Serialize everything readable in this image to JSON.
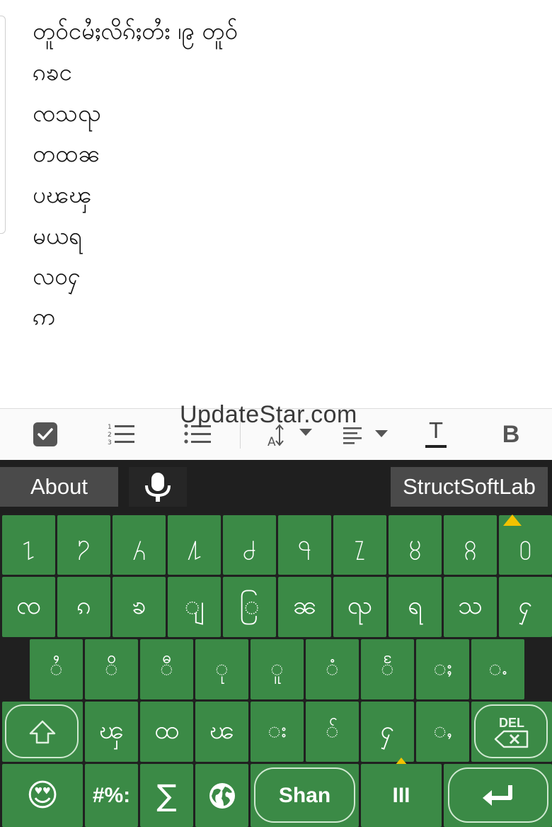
{
  "editor": {
    "lines": [
      "တူဝ်ငမႆႈလိၵ်ႈတႆး ၊၉ တူဝ်",
      "ၵၶင",
      "ၸသၺ",
      "တထၼ",
      "ပၽၾ",
      "မယရ",
      "လဝႁ",
      "ဢ"
    ]
  },
  "toolbar": {
    "watermark": "UpdateStar.com",
    "bold_label": "B",
    "text_label": "T"
  },
  "keyboard": {
    "about_label": "About",
    "brand_label": "StructSoftLab",
    "row1": [
      "႑",
      "႒",
      "႓",
      "႔",
      "႕",
      "႖",
      "႗",
      "႘",
      "႙",
      "႐"
    ],
    "row2": [
      "ၸ",
      "ၵ",
      "ၶ",
      "◌ျ",
      "ြ",
      "ၼ",
      "ၺ",
      "ရ",
      "သ",
      "ႁ"
    ],
    "row3": [
      "◌ႆ",
      "◌ိ",
      "◌ီ",
      "◌ု",
      "◌ူ",
      "◌ံ",
      "◌ႅ",
      "◌ႈ",
      "◌ႉ"
    ],
    "row4": [
      "ၾ",
      "ထ",
      "ၽ",
      "◌း",
      "◌်",
      "ႁ",
      "◌ႇ"
    ],
    "del_label": "DEL",
    "emoji_label": "😍",
    "sym_label": "#%:",
    "sum_label": "∑",
    "lang_label": "Shan",
    "space_label": "III",
    "colors": {
      "key": "#3b8a46",
      "bg": "#202020",
      "hint": "#f2c200"
    }
  }
}
